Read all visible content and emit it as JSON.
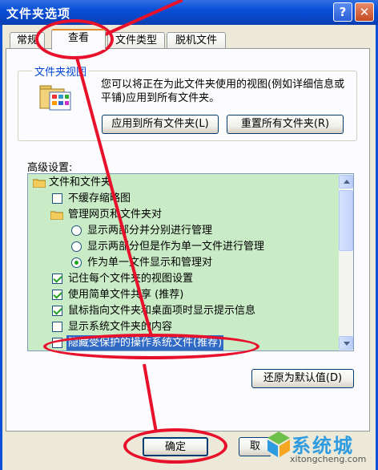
{
  "window": {
    "title": "文件夹选项",
    "help_label": "?",
    "close_label": "✕"
  },
  "tabs": [
    {
      "label": "常规"
    },
    {
      "label": "查看"
    },
    {
      "label": "文件类型"
    },
    {
      "label": "脱机文件"
    }
  ],
  "folder_views": {
    "legend": "文件夹视图",
    "description": "您可以将正在为此文件夹使用的视图(例如详细信息或平铺)应用到所有文件夹。",
    "apply_button": "应用到所有文件夹(L)",
    "reset_button": "重置所有文件夹(R)"
  },
  "advanced": {
    "label": "高级设置:",
    "items": [
      {
        "type": "folder",
        "label": "文件和文件夹"
      },
      {
        "type": "checkbox",
        "checked": false,
        "label": "不缓存缩略图"
      },
      {
        "type": "folder",
        "label": "管理网页和文件夹对"
      },
      {
        "type": "radio",
        "checked": false,
        "label": "显示两部分并分别进行管理"
      },
      {
        "type": "radio",
        "checked": false,
        "label": "显示两部分但是作为单一文件进行管理"
      },
      {
        "type": "radio",
        "checked": true,
        "label": "作为单一文件显示和管理对"
      },
      {
        "type": "checkbox",
        "checked": true,
        "label": "记住每个文件夹的视图设置"
      },
      {
        "type": "checkbox",
        "checked": true,
        "label": "使用简单文件共享 (推荐)"
      },
      {
        "type": "checkbox",
        "checked": true,
        "label": "鼠标指向文件夹和桌面项时显示提示信息"
      },
      {
        "type": "checkbox",
        "checked": false,
        "label": "显示系统文件夹的内容"
      },
      {
        "type": "checkbox",
        "checked": false,
        "selected": true,
        "label": "隐藏受保护的操作系统文件(推荐)"
      }
    ],
    "restore_button": "还原为默认值(D)"
  },
  "footer": {
    "ok_button": "确定",
    "cancel_button": "取"
  },
  "watermark": {
    "name": "系统城",
    "url": "xitongcheng.com"
  },
  "colors": {
    "titlebar": "#0a4fd8",
    "annotation": "#e8112c",
    "tree_bg": "#c9ebc6",
    "selection": "#316ac5"
  }
}
